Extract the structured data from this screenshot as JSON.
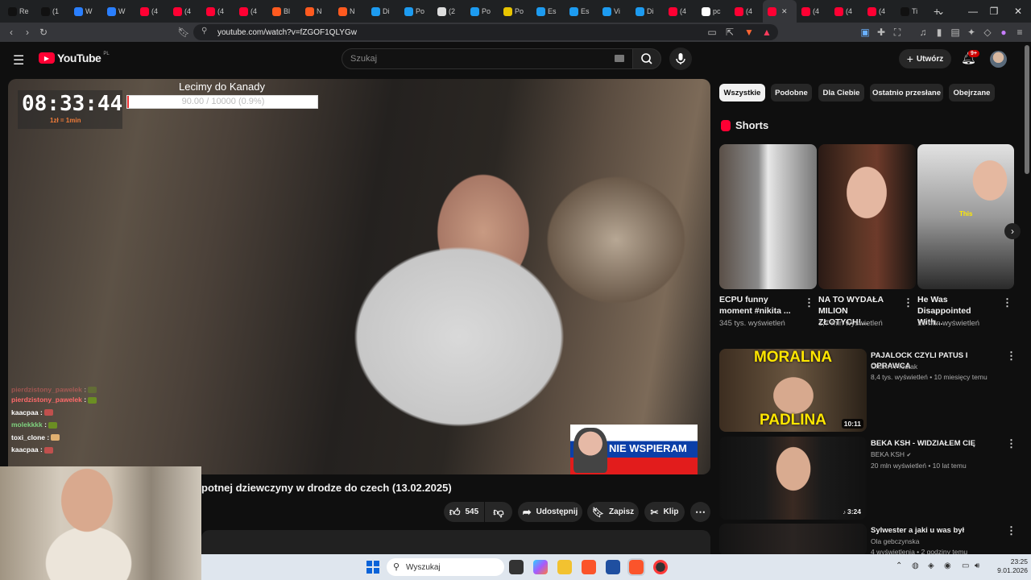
{
  "browser": {
    "tabs": [
      {
        "label": "Re",
        "color": "#111111"
      },
      {
        "label": "(1",
        "color": "#111111"
      },
      {
        "label": "W",
        "color": "#2a7fff"
      },
      {
        "label": "W",
        "color": "#2a7fff"
      },
      {
        "label": "(4",
        "color": "#ff0033"
      },
      {
        "label": "(4",
        "color": "#ff0033"
      },
      {
        "label": "(4",
        "color": "#ff0033"
      },
      {
        "label": "(4",
        "color": "#ff0033"
      },
      {
        "label": "Bl",
        "color": "#ff5a1f"
      },
      {
        "label": "N",
        "color": "#ff5a1f"
      },
      {
        "label": "N",
        "color": "#ff5a1f"
      },
      {
        "label": "Di",
        "color": "#1d9bf0"
      },
      {
        "label": "Po",
        "color": "#1d9bf0"
      },
      {
        "label": "(2",
        "color": "#dddddd"
      },
      {
        "label": "Po",
        "color": "#1d9bf0"
      },
      {
        "label": "Po",
        "color": "#e8c400"
      },
      {
        "label": "Es",
        "color": "#1d9bf0"
      },
      {
        "label": "Es",
        "color": "#1d9bf0"
      },
      {
        "label": "Vi",
        "color": "#1d9bf0"
      },
      {
        "label": "Di",
        "color": "#1d9bf0"
      },
      {
        "label": "(4",
        "color": "#ff0033"
      },
      {
        "label": "pc",
        "color": "#ffffff"
      },
      {
        "label": "(4",
        "color": "#ff0033"
      },
      {
        "label": "",
        "color": "#ff0033",
        "active": true
      },
      {
        "label": "(4",
        "color": "#ff0033"
      },
      {
        "label": "(4",
        "color": "#ff0033"
      },
      {
        "label": "(4",
        "color": "#ff0033"
      },
      {
        "label": "Ti",
        "color": "#111111"
      }
    ],
    "new_tab": "+",
    "url": "youtube.com/watch?v=fZGOF1QLYGw"
  },
  "yt": {
    "logo_text": "YouTube",
    "logo_region": "PL",
    "search_placeholder": "Szukaj",
    "create_label": "Utwórz",
    "notif_badge": "9+"
  },
  "video": {
    "timer": "08:33:44",
    "timer_note": "1zł = 1min",
    "goal_title": "Lecimy do Kanady",
    "goal_progress": "90.00 / 10000 (0.9%)",
    "goal_fraction": 0.009,
    "banner_text": "NIE WSPIERAM",
    "chat": [
      {
        "user": "pierdzistony_pawelek",
        "color": "#ff6a6a",
        "msg": ":",
        "emo": "#6b8e23"
      },
      {
        "user": "pierdzistony_pawelek",
        "color": "#ff6a6a",
        "msg": ":",
        "emo": "#6b8e23"
      },
      {
        "user": "kaacpaa",
        "color": "#ffffff",
        "msg": ":",
        "emo": "#c0504d"
      },
      {
        "user": "molekkkk",
        "color": "#7fd37f",
        "msg": ":",
        "emo": "#6b8e23"
      },
      {
        "user": "toxi_clone",
        "color": "#ffffff",
        "msg": ":",
        "emo": "#e0b070"
      },
      {
        "user": "kaacpaa",
        "color": "#ffffff",
        "msg": ":",
        "emo": "#c0504d"
      }
    ]
  },
  "watch": {
    "title": "potnej dziewczyny w drodze do czech (13.02.2025)",
    "likes": "545",
    "share_label": "Udostępnij",
    "save_label": "Zapisz",
    "clip_label": "Klip"
  },
  "chips": [
    "Wszystkie",
    "Podobne",
    "Dla Ciebie",
    "Ostatnio przesłane",
    "Obejrzane"
  ],
  "shorts": {
    "heading": "Shorts",
    "items": [
      {
        "title": "ECPU funny moment #nikita ...",
        "views": "345 tys. wyświetleń"
      },
      {
        "title": "NA TO WYDAŁA MILION ZŁOTYCH!...",
        "views": "1,7 mln wyświetleń"
      },
      {
        "title": "He Was Disappointed With...",
        "views": "10 mln wyświetleń",
        "thumb_text": "This"
      }
    ]
  },
  "recs": [
    {
      "title": "PAJALOCK CZYLI PATUS I OPRAWCA",
      "channel": "Cham i Prostak",
      "meta": "8,4 tys. wyświetleń • 10 miesięcy temu",
      "duration": "10:11",
      "thumb_top": "MORALNA",
      "thumb_bottom": "PADLINA"
    },
    {
      "title": "BEKA KSH - WIDZIAŁEM CIĘ",
      "channel": "BEKA KSH",
      "meta": "20 mln wyświetleń • 10 lat temu",
      "duration": "3:24"
    },
    {
      "title": "Sylwester a jaki u was był",
      "channel": "Ola gebczynska",
      "meta": "4 wyświetlenia • 2 godziny temu"
    }
  ],
  "taskbar": {
    "search": "Wyszukaj",
    "time": "23:25",
    "date": "9.01.2026"
  }
}
